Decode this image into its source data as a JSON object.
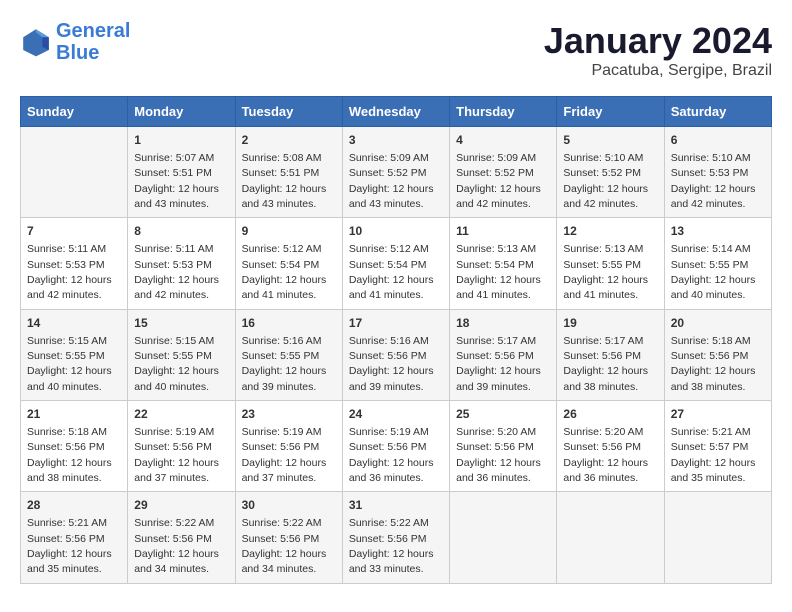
{
  "header": {
    "logo_line1": "General",
    "logo_line2": "Blue",
    "main_title": "January 2024",
    "subtitle": "Pacatuba, Sergipe, Brazil"
  },
  "days_of_week": [
    "Sunday",
    "Monday",
    "Tuesday",
    "Wednesday",
    "Thursday",
    "Friday",
    "Saturday"
  ],
  "weeks": [
    [
      {
        "day": "",
        "info": ""
      },
      {
        "day": "1",
        "info": "Sunrise: 5:07 AM\nSunset: 5:51 PM\nDaylight: 12 hours\nand 43 minutes."
      },
      {
        "day": "2",
        "info": "Sunrise: 5:08 AM\nSunset: 5:51 PM\nDaylight: 12 hours\nand 43 minutes."
      },
      {
        "day": "3",
        "info": "Sunrise: 5:09 AM\nSunset: 5:52 PM\nDaylight: 12 hours\nand 43 minutes."
      },
      {
        "day": "4",
        "info": "Sunrise: 5:09 AM\nSunset: 5:52 PM\nDaylight: 12 hours\nand 42 minutes."
      },
      {
        "day": "5",
        "info": "Sunrise: 5:10 AM\nSunset: 5:52 PM\nDaylight: 12 hours\nand 42 minutes."
      },
      {
        "day": "6",
        "info": "Sunrise: 5:10 AM\nSunset: 5:53 PM\nDaylight: 12 hours\nand 42 minutes."
      }
    ],
    [
      {
        "day": "7",
        "info": "Sunrise: 5:11 AM\nSunset: 5:53 PM\nDaylight: 12 hours\nand 42 minutes."
      },
      {
        "day": "8",
        "info": "Sunrise: 5:11 AM\nSunset: 5:53 PM\nDaylight: 12 hours\nand 42 minutes."
      },
      {
        "day": "9",
        "info": "Sunrise: 5:12 AM\nSunset: 5:54 PM\nDaylight: 12 hours\nand 41 minutes."
      },
      {
        "day": "10",
        "info": "Sunrise: 5:12 AM\nSunset: 5:54 PM\nDaylight: 12 hours\nand 41 minutes."
      },
      {
        "day": "11",
        "info": "Sunrise: 5:13 AM\nSunset: 5:54 PM\nDaylight: 12 hours\nand 41 minutes."
      },
      {
        "day": "12",
        "info": "Sunrise: 5:13 AM\nSunset: 5:55 PM\nDaylight: 12 hours\nand 41 minutes."
      },
      {
        "day": "13",
        "info": "Sunrise: 5:14 AM\nSunset: 5:55 PM\nDaylight: 12 hours\nand 40 minutes."
      }
    ],
    [
      {
        "day": "14",
        "info": "Sunrise: 5:15 AM\nSunset: 5:55 PM\nDaylight: 12 hours\nand 40 minutes."
      },
      {
        "day": "15",
        "info": "Sunrise: 5:15 AM\nSunset: 5:55 PM\nDaylight: 12 hours\nand 40 minutes."
      },
      {
        "day": "16",
        "info": "Sunrise: 5:16 AM\nSunset: 5:55 PM\nDaylight: 12 hours\nand 39 minutes."
      },
      {
        "day": "17",
        "info": "Sunrise: 5:16 AM\nSunset: 5:56 PM\nDaylight: 12 hours\nand 39 minutes."
      },
      {
        "day": "18",
        "info": "Sunrise: 5:17 AM\nSunset: 5:56 PM\nDaylight: 12 hours\nand 39 minutes."
      },
      {
        "day": "19",
        "info": "Sunrise: 5:17 AM\nSunset: 5:56 PM\nDaylight: 12 hours\nand 38 minutes."
      },
      {
        "day": "20",
        "info": "Sunrise: 5:18 AM\nSunset: 5:56 PM\nDaylight: 12 hours\nand 38 minutes."
      }
    ],
    [
      {
        "day": "21",
        "info": "Sunrise: 5:18 AM\nSunset: 5:56 PM\nDaylight: 12 hours\nand 38 minutes."
      },
      {
        "day": "22",
        "info": "Sunrise: 5:19 AM\nSunset: 5:56 PM\nDaylight: 12 hours\nand 37 minutes."
      },
      {
        "day": "23",
        "info": "Sunrise: 5:19 AM\nSunset: 5:56 PM\nDaylight: 12 hours\nand 37 minutes."
      },
      {
        "day": "24",
        "info": "Sunrise: 5:19 AM\nSunset: 5:56 PM\nDaylight: 12 hours\nand 36 minutes."
      },
      {
        "day": "25",
        "info": "Sunrise: 5:20 AM\nSunset: 5:56 PM\nDaylight: 12 hours\nand 36 minutes."
      },
      {
        "day": "26",
        "info": "Sunrise: 5:20 AM\nSunset: 5:56 PM\nDaylight: 12 hours\nand 36 minutes."
      },
      {
        "day": "27",
        "info": "Sunrise: 5:21 AM\nSunset: 5:57 PM\nDaylight: 12 hours\nand 35 minutes."
      }
    ],
    [
      {
        "day": "28",
        "info": "Sunrise: 5:21 AM\nSunset: 5:56 PM\nDaylight: 12 hours\nand 35 minutes."
      },
      {
        "day": "29",
        "info": "Sunrise: 5:22 AM\nSunset: 5:56 PM\nDaylight: 12 hours\nand 34 minutes."
      },
      {
        "day": "30",
        "info": "Sunrise: 5:22 AM\nSunset: 5:56 PM\nDaylight: 12 hours\nand 34 minutes."
      },
      {
        "day": "31",
        "info": "Sunrise: 5:22 AM\nSunset: 5:56 PM\nDaylight: 12 hours\nand 33 minutes."
      },
      {
        "day": "",
        "info": ""
      },
      {
        "day": "",
        "info": ""
      },
      {
        "day": "",
        "info": ""
      }
    ]
  ]
}
